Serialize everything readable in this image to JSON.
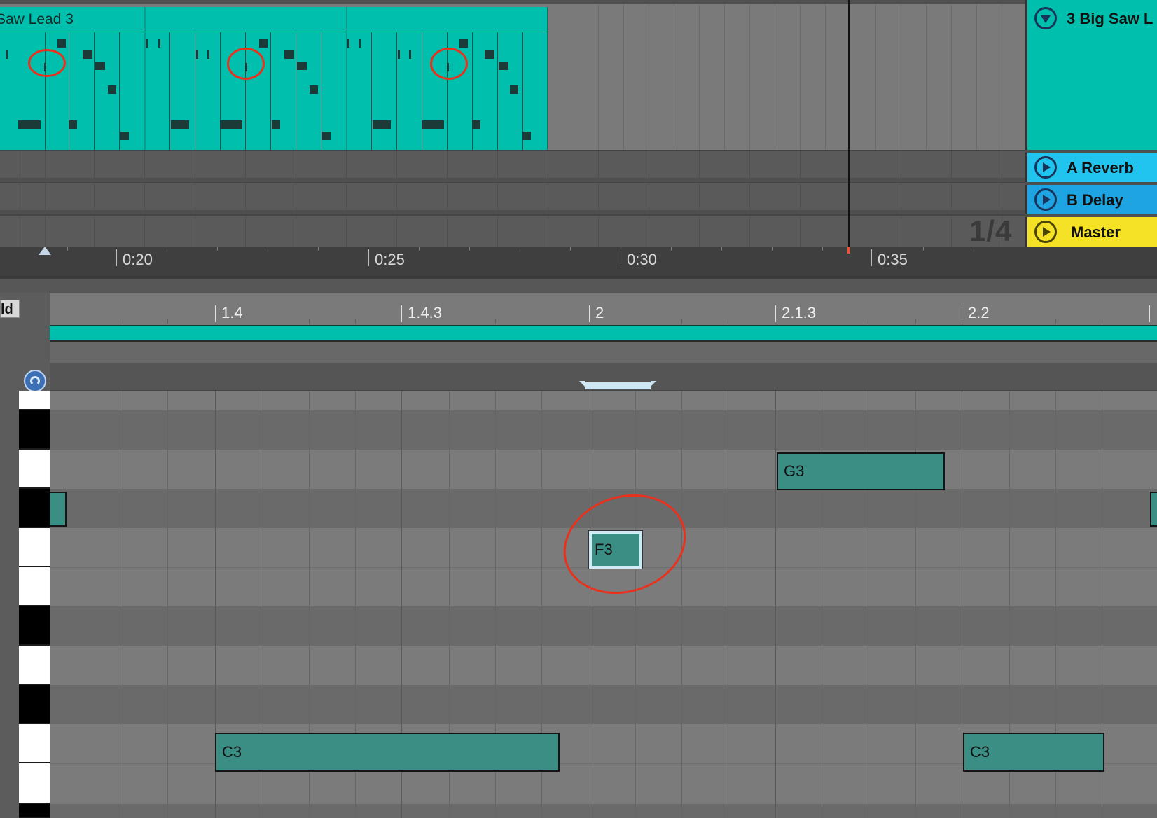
{
  "arrangement": {
    "clip_name": "Saw Lead 3",
    "ruler_labels": [
      "0:20",
      "0:25",
      "0:30",
      "0:35"
    ],
    "page_count": "1/4"
  },
  "tracks": [
    {
      "name": "3 Big Saw L",
      "color": "#00bfad",
      "button": "fold-down"
    },
    {
      "name": "A Reverb",
      "color": "#21c4ef",
      "button": "play"
    },
    {
      "name": "B Delay",
      "color": "#1ea4e3",
      "button": "play"
    },
    {
      "name": "Master",
      "color": "#f5e125",
      "button": "play"
    }
  ],
  "piano_roll": {
    "fold_label": "ld",
    "ruler_labels": [
      "1.4",
      "1.4.3",
      "2",
      "2.1.3",
      "2.2"
    ],
    "notes": [
      {
        "label": "G3"
      },
      {
        "label": "F3",
        "selected": true
      },
      {
        "label": "C3"
      },
      {
        "label": "C3"
      }
    ]
  },
  "colors": {
    "clip": "#00bfad",
    "note": "#3a8e84",
    "annotation": "#e8321e"
  }
}
